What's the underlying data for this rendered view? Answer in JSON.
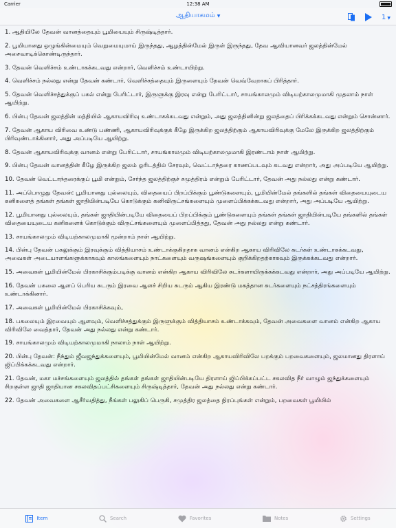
{
  "status": {
    "carrier": "Carrier",
    "time": "12:38 AM"
  },
  "nav": {
    "title": "ஆதியாகமம்",
    "chapter": "1"
  },
  "verses": [
    "1. ஆதியிலே தேவன் வானத்தையும் பூமியையும் சிருஷ்டித்தார்.",
    "2. பூமியானது ஒழுங்கின்மையும் வெறுமையுமாய் இருந்தது, ஆழத்தின்மேல் இருள் இருந்தது, தேவ ஆவியானவர் ஜலத்தின்மேல் அசைவாடிக்கொண்டிருந்தார்.",
    "3. தேவன் வெளிச்சம் உண்டாகக்கடவது என்றார், வெளிச்சம் உண்டாயிற்று.",
    "4. வெளிச்சம் நல்லது என்று தேவன் கண்டார், வெளிச்சத்தையும் இருளையும் தேவன் வெவ்வேறாகப் பிரித்தார்.",
    "5. தேவன் வெளிச்சத்துக்குப் பகல் என்று பேரிட்டார், இருளுக்கு இரவு என்று பேரிட்டார், சாயங்காலமும் விடியற்காலமுமாகி முதலாம் நாள் ஆயிற்று.",
    "6. பின்பு தேவன் ஜலத்தின் மத்தியில் ஆகாயவிரிவு உண்டாகக்கடவது என்றும், அது ஜலத்தினின்று ஜலத்தைப் பிரிக்கக்கடவது என்றும் சொன்னார்.",
    "7. தேவன் ஆகாய விரிவை உண்டு பண்ணி, ஆகாயவிரிவுக்குக் கீழே இருக்கிற ஜலத்திற்கும் ஆகாயவிரிவுக்கு மேலே இருக்கிற ஜலத்திற்கும் பிரிவுண்டாக்கினார், அது அப்படியே ஆயிற்று.",
    "8. தேவன் ஆகாயவிரிவுக்கு வானம் என்று பேரிட்டார், சாயங்காலமும் விடியற்காலமுமாகி இரண்டாம் நாள் ஆயிற்று.",
    "9. பின்பு தேவன் வானத்தின் கீழே இருக்கிற ஜலம் ஓரிடத்தில் சேரவும், வெட்டாந்தரை காணப்படவும் கடவது என்றார், அது அப்படியே ஆயிற்று.",
    "10. தேவன் வெட்டாந்தரைக்குப் பூமி என்றும், சேர்ந்த ஜலத்திற்குச் சமுத்திரம் என்றும் பேரிட்டார், தேவன் அது நல்லது என்று கண்டார்.",
    "11. அப்பொழுது தேவன்: பூமியானது புல்லையும், விதையைப் பிறப்பிக்கும் பூண்டுகளையும், பூமியின்மேல் தங்களில் தங்கள் விதையையுடைய கனிகளைத் தங்கள் தங்கள் ஜாதியின்படியே கொடுக்கும் கனிவிருட்சங்களையும் முளைப்பிக்கக்கடவது என்றார், அது அப்படியே ஆயிற்று.",
    "12. பூமியானது புல்லையும், தங்கள் ஜாதியின்படியே விதையைப் பிறப்பிக்கும் பூண்டுகளையும் தங்கள் தங்கள் ஜாதியின்படியே தங்களில் தங்கள் விதையையுடைய கனிகளைக் கொடுக்கும் விருட்சங்களையும் முளைப்பித்தது, தேவன் அது நல்லது என்று கண்டார்.",
    "13. சாயங்காலமும் விடியற்காலமுமாகி மூன்றாம் நாள் ஆயிற்று.",
    "14. பின்பு தேவன் பகலுக்கும் இரவுக்கும் வித்தியாசம் உண்டாக்குகிறதாக வானம் என்கிற ஆகாய விரிவிலே சுடர்கள் உண்டாகக்கடவது, அவைகள் அடையாளங்களுக்காகவும் காலங்களையும் நாட்களையும் வருஷங்களையும் குறிக்கிறதற்காகவும் இருக்கக்கடவது என்றார்.",
    "15. அவைகள் பூமியின்மேல் பிரகாசிக்கும்படிக்கு வானம் என்கிற ஆகாய விரிவிலே சுடர்களாயிருக்கக்கடவது என்றார், அது அப்படியே ஆயிற்று.",
    "16. தேவன் பகலை ஆளப் பெரிய சுடரும் இரவை ஆளச் சிறிய சுடரும் ஆகிய இரண்டு மகத்தான சுடர்களையும் நட்சத்திரங்களையும் உண்டாக்கினார்.",
    "17. அவைகள் பூமியின்மேல் பிரகாசிக்கவும்,",
    "18. பகலையும் இரவையும் ஆளவும், வெளிச்சத்துக்கும் இருளுக்கும் வித்தியாசம் உண்டாக்கவும், தேவன் அவைகளை வானம் என்கிற ஆகாய விரிவிலே வைத்தார், தேவன் அது நல்லது என்று கண்டார்.",
    "19. சாயங்காலமும் விடியற்காலமுமாகி நாலாம் நாள் ஆயிற்று.",
    "20. பின்பு தேவன்: நீந்தும் ஜீவஜந்துக்களையும், பூமியின்மேல் வானம் என்கிற ஆகாயவிரிவிலே பறக்கும் பறவைகளையும், ஜலமானது திரளாய் ஜிப்பிக்கக்கடவது என்றார்.",
    "21. தேவன், மகா மச்சங்களையும் ஜலத்தில் தங்கள் தங்கள் ஜாதியின்படியே திரளாய் ஜிப்பிக்கப்பட்ட சகலவித நீர் வாழும் ஜந்துக்களையும் சிறகுள்ள ஜாதி ஜாதியான சகலவிதப்பட்சிகளையும் சிருஷ்டித்தார், தேவன் அது நல்லது என்று கண்டார்.",
    "22. தேவன் அவைகளை ஆசீர்வதித்து, நீங்கள் பலுகிப் பெருகி, சமுத்திர ஜலத்தை நிரப்புங்கள் என்றும், பறவைகள் பூமியில்"
  ],
  "tabs": [
    {
      "label": "Item",
      "icon": "book-icon",
      "active": true
    },
    {
      "label": "Search",
      "icon": "search-icon",
      "active": false
    },
    {
      "label": "Favorites",
      "icon": "heart-icon",
      "active": false
    },
    {
      "label": "Notes",
      "icon": "folder-icon",
      "active": false
    },
    {
      "label": "Settings",
      "icon": "gear-icon",
      "active": false
    }
  ],
  "colors": {
    "accent": "#1b6ef3",
    "inactive": "#a3a3a8"
  }
}
